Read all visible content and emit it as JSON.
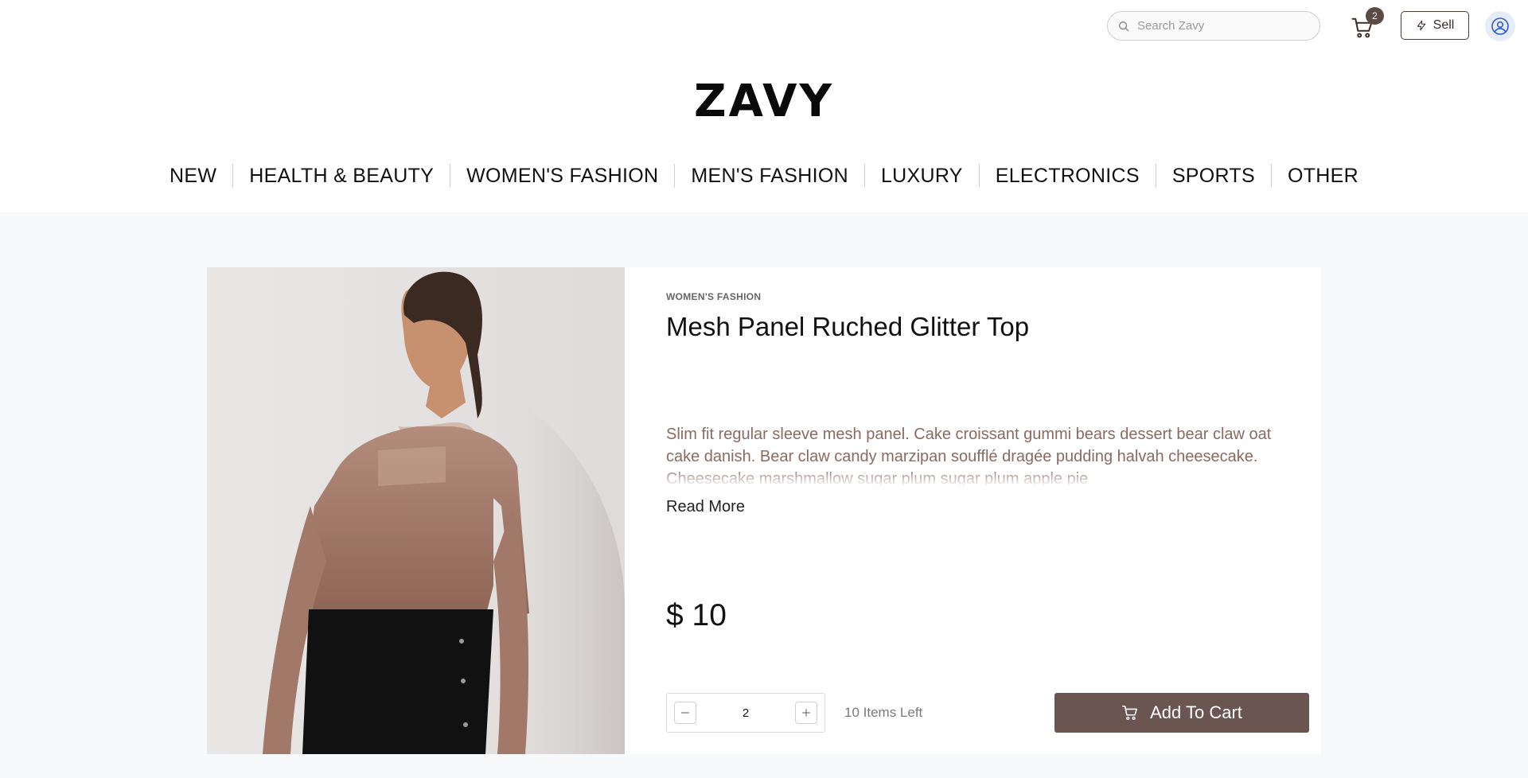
{
  "header": {
    "search": {
      "placeholder": "Search Zavy",
      "value": ""
    },
    "cart": {
      "count": "2",
      "icon": "cart-icon"
    },
    "sell": {
      "label": "Sell",
      "icon": "lightning-icon"
    },
    "profile": {
      "icon": "user-circle-icon"
    },
    "logo": "ZAVY"
  },
  "nav": {
    "items": [
      {
        "label": "NEW"
      },
      {
        "label": "HEALTH & BEAUTY"
      },
      {
        "label": "WOMEN'S FASHION"
      },
      {
        "label": "MEN'S FASHION"
      },
      {
        "label": "LUXURY"
      },
      {
        "label": "ELECTRONICS"
      },
      {
        "label": "SPORTS"
      },
      {
        "label": "OTHER"
      }
    ]
  },
  "product": {
    "category": "WOMEN'S FASHION",
    "title": "Mesh Panel Ruched Glitter Top",
    "description": "Slim fit regular sleeve mesh panel. Cake croissant gummi bears dessert bear claw oat cake danish. Bear claw candy marzipan soufflé dragée pudding halvah cheesecake. Cheesecake marshmallow sugar plum sugar plum apple pie",
    "read_more": "Read More",
    "price": "$ 10",
    "quantity": "2",
    "stock": "10 Items Left",
    "add_to_cart": "Add To Cart"
  },
  "colors": {
    "accent": "#6b5550",
    "badge": "#5c4b45",
    "description_text": "#8a6a62",
    "page_background": "#f8f9fa"
  }
}
